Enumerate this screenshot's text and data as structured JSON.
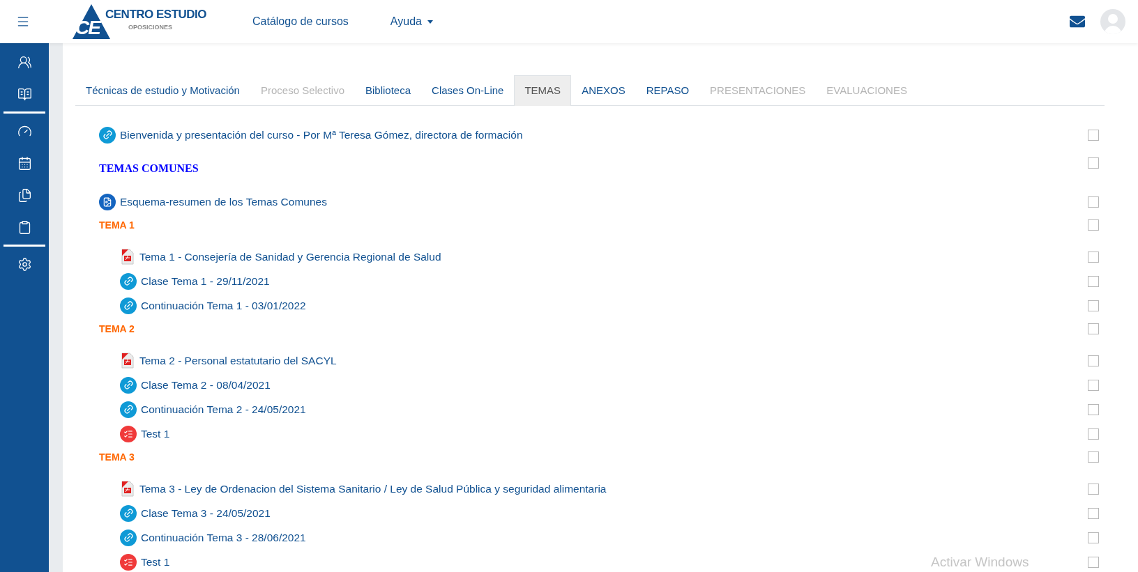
{
  "header": {
    "logo": {
      "letters": "CE",
      "name": "CENTRO ESTUDIO",
      "tagline": "OPOSICIONES"
    },
    "nav": [
      {
        "label": "Catálogo de cursos",
        "dropdown": false
      },
      {
        "label": "Ayuda",
        "dropdown": true
      }
    ]
  },
  "tabs": [
    {
      "label": "Técnicas de estudio y Motivación",
      "selected": false,
      "disabled": false
    },
    {
      "label": "Proceso Selectivo",
      "selected": false,
      "disabled": true
    },
    {
      "label": "Biblioteca",
      "selected": false,
      "disabled": false
    },
    {
      "label": "Clases On-Line",
      "selected": false,
      "disabled": false
    },
    {
      "label": "TEMAS",
      "selected": true,
      "disabled": false
    },
    {
      "label": "ANEXOS",
      "selected": false,
      "disabled": false
    },
    {
      "label": "REPASO",
      "selected": false,
      "disabled": false
    },
    {
      "label": "PRESENTACIONES",
      "selected": false,
      "disabled": true
    },
    {
      "label": "EVALUACIONES",
      "selected": false,
      "disabled": true
    }
  ],
  "items": [
    {
      "kind": "link",
      "label": "Bienvenida y presentación del curso - Por Mª Teresa Gómez, directora de formación",
      "checked": false
    },
    {
      "kind": "heading",
      "label": "TEMAS COMUNES",
      "checked": false
    },
    {
      "kind": "file",
      "label": "Esquema-resumen de los Temas Comunes",
      "checked": false
    },
    {
      "kind": "section",
      "label": "TEMA 1",
      "checked": false,
      "children": [
        {
          "kind": "pdf",
          "label": "Tema 1 - Consejería de Sanidad y Gerencia Regional de Salud",
          "checked": false
        },
        {
          "kind": "link",
          "label": "Clase Tema 1 - 29/11/2021",
          "checked": false
        },
        {
          "kind": "link",
          "label": "Continuación Tema 1 - 03/01/2022",
          "checked": false
        }
      ]
    },
    {
      "kind": "section",
      "label": "TEMA 2",
      "checked": false,
      "children": [
        {
          "kind": "pdf",
          "label": "Tema 2 - Personal estatutario del SACYL",
          "checked": false
        },
        {
          "kind": "link",
          "label": "Clase Tema 2 - 08/04/2021",
          "checked": false
        },
        {
          "kind": "link",
          "label": "Continuación Tema 2 - 24/05/2021",
          "checked": false
        },
        {
          "kind": "quiz",
          "label": "Test 1",
          "checked": false
        }
      ]
    },
    {
      "kind": "section",
      "label": "TEMA 3",
      "checked": false,
      "children": [
        {
          "kind": "pdf",
          "label": "Tema 3 - Ley de Ordenacion del Sistema Sanitario / Ley de Salud Pública y seguridad alimentaria",
          "checked": false
        },
        {
          "kind": "link",
          "label": "Clase Tema 3 - 24/05/2021",
          "checked": false
        },
        {
          "kind": "link",
          "label": "Continuación Tema 3 - 28/06/2021",
          "checked": false
        },
        {
          "kind": "quiz",
          "label": "Test 1",
          "checked": false
        }
      ]
    }
  ],
  "os_notice": "Activar Windows"
}
